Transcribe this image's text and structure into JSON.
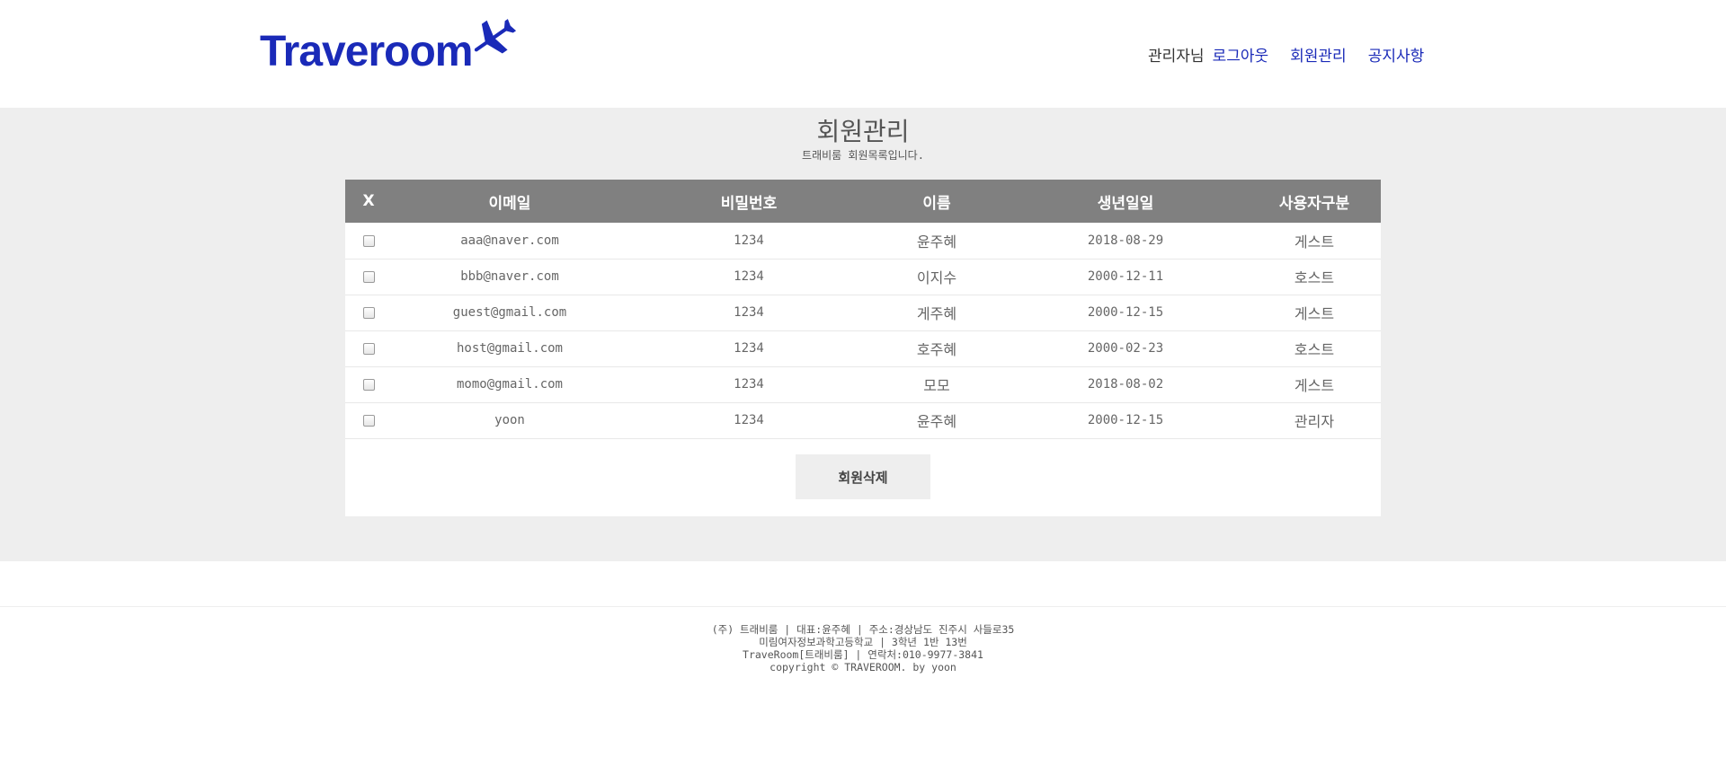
{
  "header": {
    "logo_text": "Traveroom",
    "user_label": "관리자님",
    "nav": [
      "로그아웃",
      "회원관리",
      "공지사항"
    ]
  },
  "page": {
    "title": "회원관리",
    "subtitle": "트래비룸 회원목록입니다."
  },
  "table": {
    "columns": [
      "X",
      "이메일",
      "비밀번호",
      "이름",
      "생년일일",
      "사용자구분"
    ],
    "rows": [
      {
        "email": "aaa@naver.com",
        "password": "1234",
        "name": "윤주혜",
        "birth": "2018-08-29",
        "type": "게스트"
      },
      {
        "email": "bbb@naver.com",
        "password": "1234",
        "name": "이지수",
        "birth": "2000-12-11",
        "type": "호스트"
      },
      {
        "email": "guest@gmail.com",
        "password": "1234",
        "name": "게주혜",
        "birth": "2000-12-15",
        "type": "게스트"
      },
      {
        "email": "host@gmail.com",
        "password": "1234",
        "name": "호주혜",
        "birth": "2000-02-23",
        "type": "호스트"
      },
      {
        "email": "momo@gmail.com",
        "password": "1234",
        "name": "모모",
        "birth": "2018-08-02",
        "type": "게스트"
      },
      {
        "email": "yoon",
        "password": "1234",
        "name": "윤주혜",
        "birth": "2000-12-15",
        "type": "관리자"
      }
    ],
    "delete_button": "회원삭제"
  },
  "footer": {
    "lines": [
      "(주) 트래비룸 | 대표:윤주혜 | 주소:경상남도 진주시 사들로35",
      "미림여자정보과학고등학교 | 3학년 1반 13번",
      "TraveRoom[트래비룸] | 연락처:010-9977-3841",
      "copyright © TRAVEROOM. by yoon"
    ]
  },
  "colors": {
    "brand": "#1a2ab8",
    "table_header_bg": "#808080",
    "page_bg": "#eeeeee"
  }
}
